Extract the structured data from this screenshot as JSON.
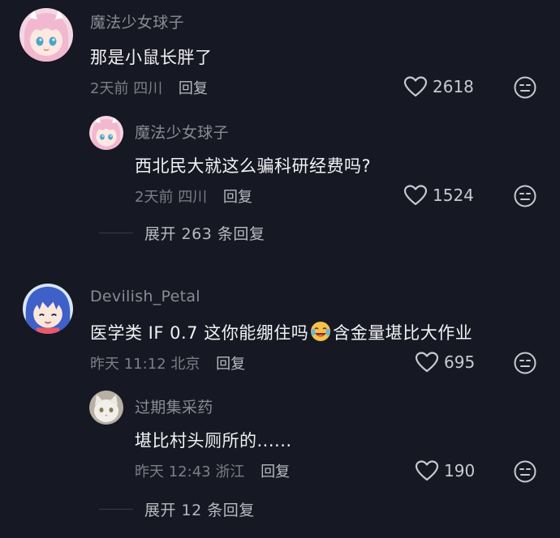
{
  "comments": [
    {
      "username": "魔法少女球子",
      "text": "那是小鼠长胖了",
      "time": "2天前",
      "location": "四川",
      "reply_label": "回复",
      "likes": "2618",
      "avatar": "anime-girl-pink-hair",
      "reply": {
        "username": "魔法少女球子",
        "text": "西北民大就这么骗科研经费吗?",
        "time": "2天前",
        "location": "四川",
        "reply_label": "回复",
        "likes": "1524",
        "avatar": "anime-girl-pink-hair"
      },
      "expand_label": "展开 263 条回复"
    },
    {
      "username": "Devilish_Petal",
      "text_before": "医学类 IF 0.7 这你能绷住吗",
      "emoji": "crying-laughing-face",
      "text_after": "含金量堪比大作业",
      "time": "昨天 11:12",
      "location": "北京",
      "reply_label": "回复",
      "likes": "695",
      "avatar": "anime-girl-blue-hair",
      "reply": {
        "username": "过期集采药",
        "text": "堪比村头厕所的......",
        "time": "昨天 12:43",
        "location": "浙江",
        "reply_label": "回复",
        "likes": "190",
        "avatar": "white-cat"
      },
      "expand_label": "展开 12 条回复"
    }
  ],
  "colors": {
    "background": "#161823",
    "username": "#8a8b93",
    "text": "#f2f2f4",
    "meta": "#7d7e86"
  }
}
